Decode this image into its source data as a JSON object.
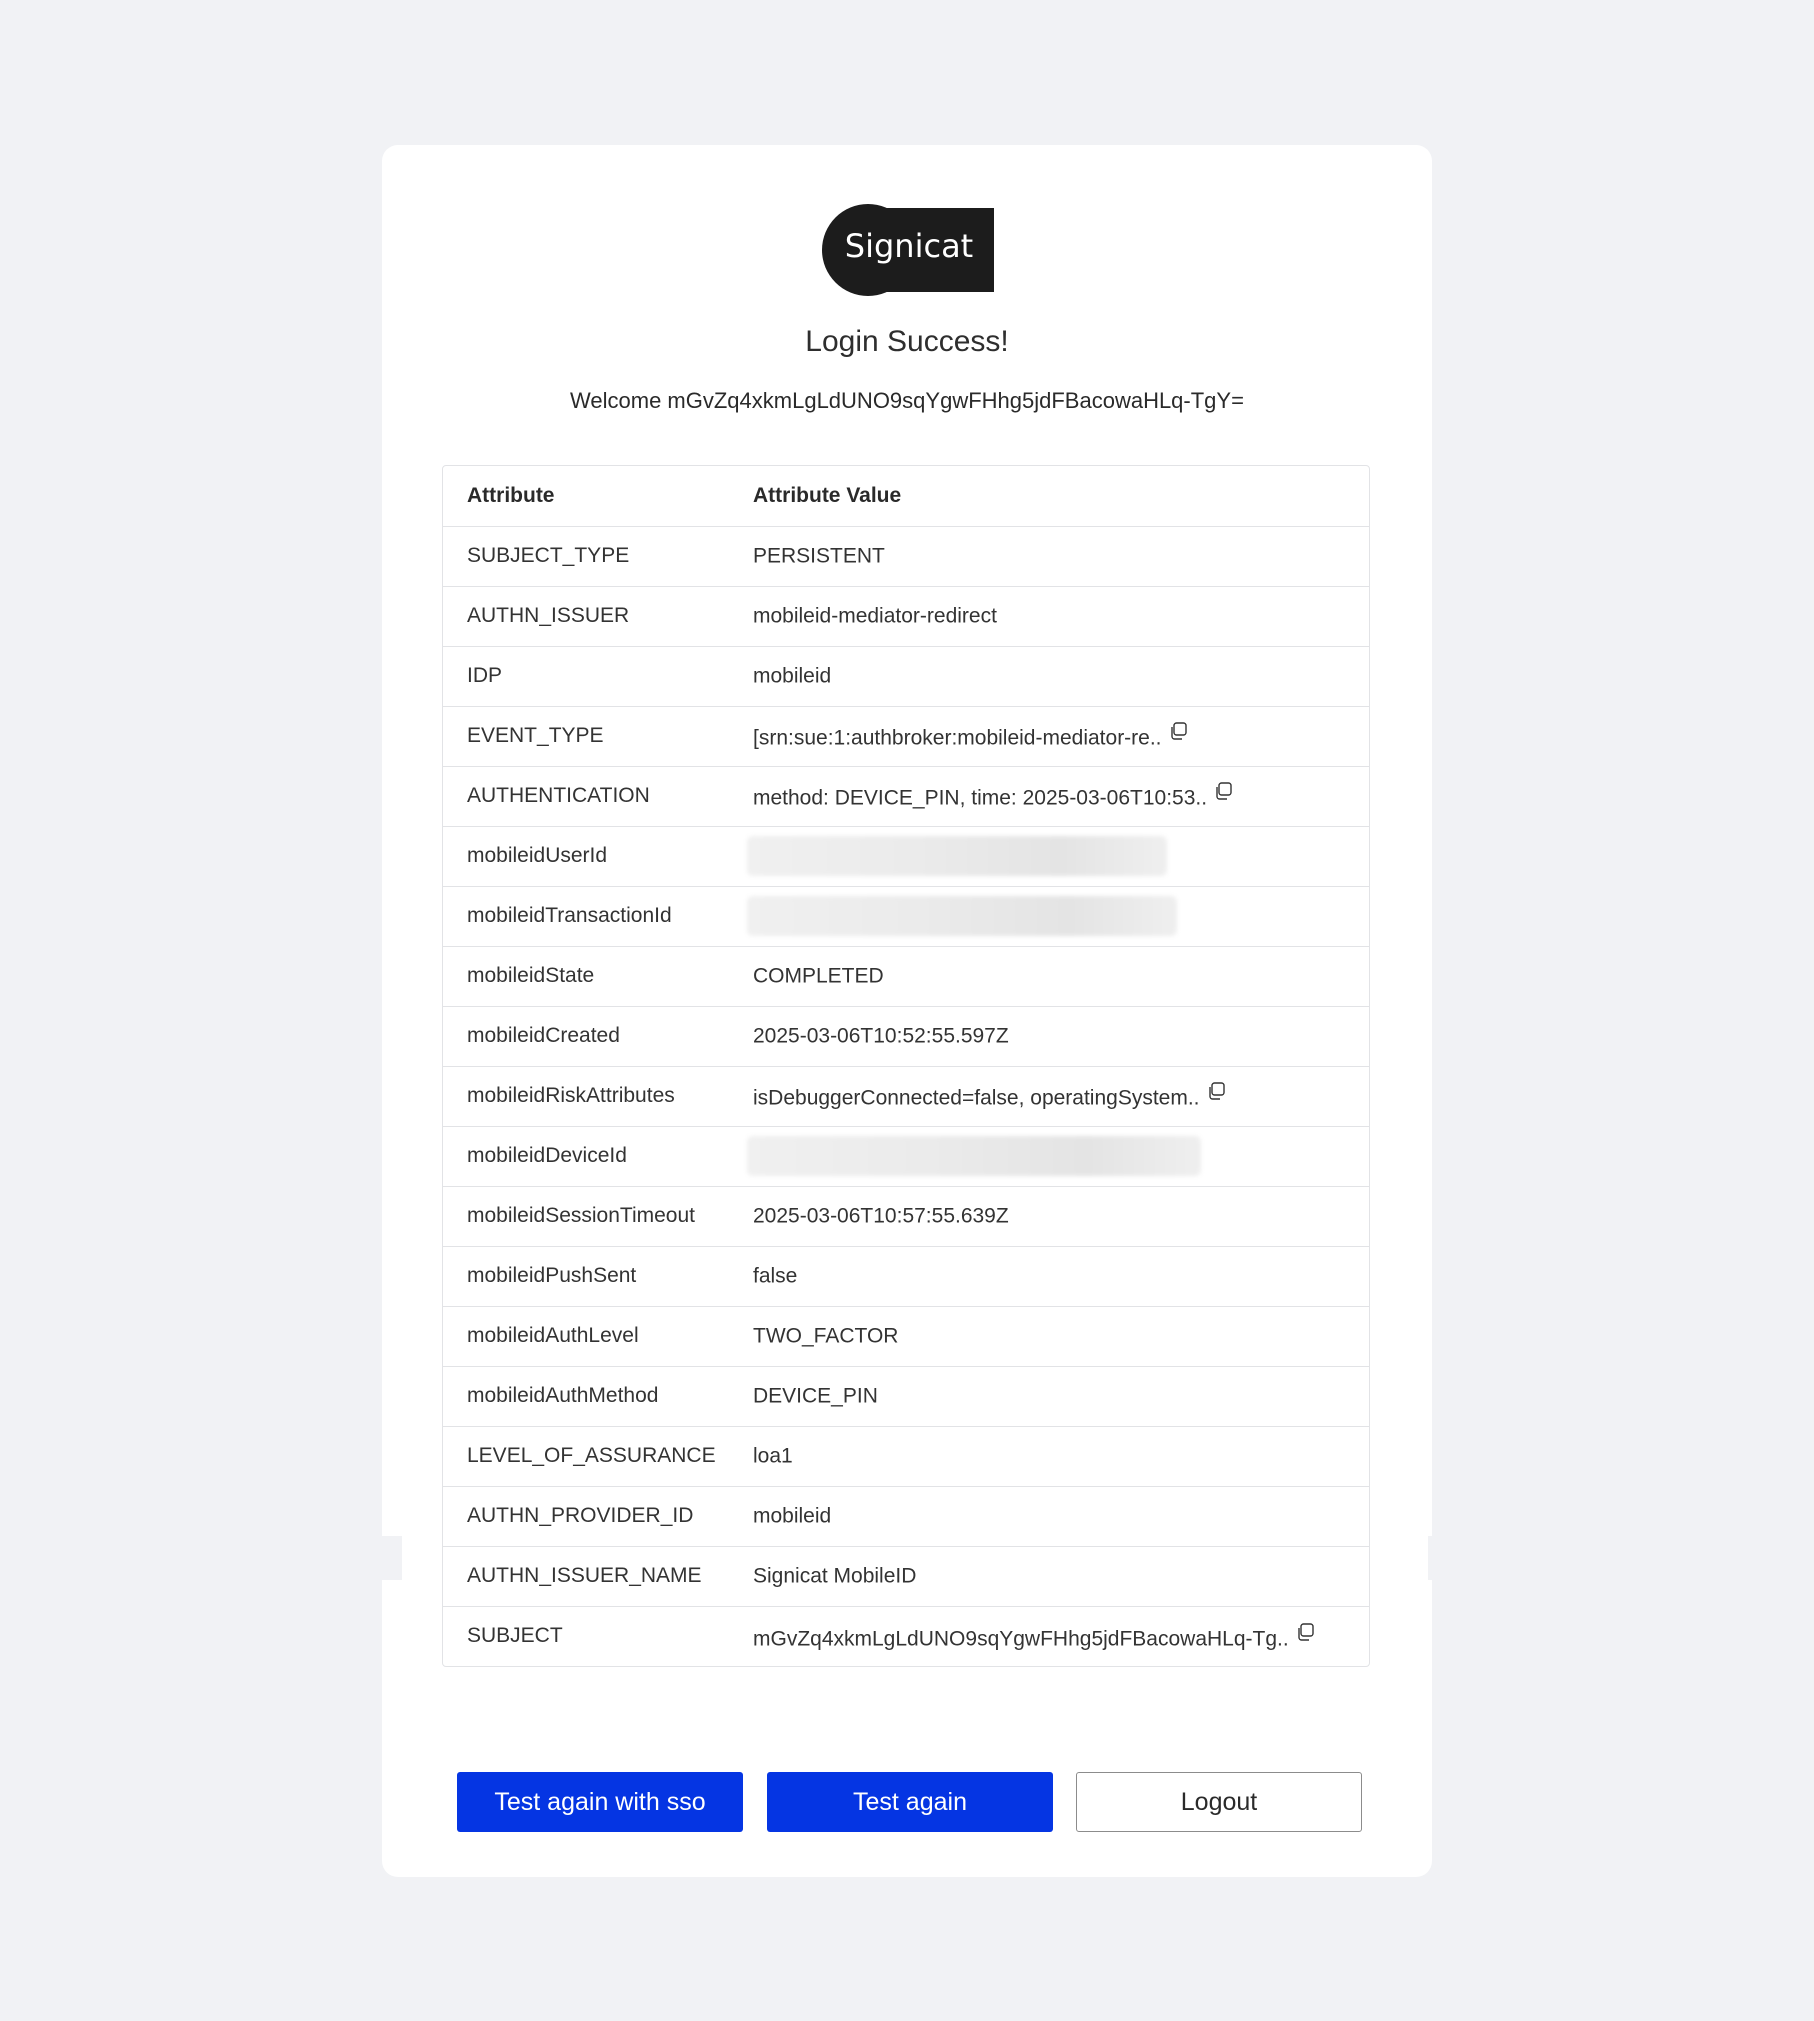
{
  "brand": {
    "logo_text": "Signicat"
  },
  "header": {
    "title": "Login Success!",
    "welcome": "Welcome mGvZq4xkmLgLdUNO9sqYgwFHhg5jdFBacowaHLq-TgY="
  },
  "table": {
    "headers": [
      "Attribute",
      "Attribute Value"
    ],
    "rows": [
      {
        "attr": "SUBJECT_TYPE",
        "value": "PERSISTENT",
        "copy": false,
        "redacted": false
      },
      {
        "attr": "AUTHN_ISSUER",
        "value": "mobileid-mediator-redirect",
        "copy": false,
        "redacted": false
      },
      {
        "attr": "IDP",
        "value": "mobileid",
        "copy": false,
        "redacted": false
      },
      {
        "attr": "EVENT_TYPE",
        "value": "[srn:sue:1:authbroker:mobileid-mediator-re..",
        "copy": true,
        "redacted": false
      },
      {
        "attr": "AUTHENTICATION",
        "value": "method: DEVICE_PIN, time: 2025-03-06T10:53..",
        "copy": true,
        "redacted": false
      },
      {
        "attr": "mobileidUserId",
        "value": "",
        "copy": false,
        "redacted": true
      },
      {
        "attr": "mobileidTransactionId",
        "value": "",
        "copy": false,
        "redacted": true
      },
      {
        "attr": "mobileidState",
        "value": "COMPLETED",
        "copy": false,
        "redacted": false
      },
      {
        "attr": "mobileidCreated",
        "value": "2025-03-06T10:52:55.597Z",
        "copy": false,
        "redacted": false
      },
      {
        "attr": "mobileidRiskAttributes",
        "value": "isDebuggerConnected=false, operatingSystem..",
        "copy": true,
        "redacted": false
      },
      {
        "attr": "mobileidDeviceId",
        "value": "",
        "copy": false,
        "redacted": true
      },
      {
        "attr": "mobileidSessionTimeout",
        "value": "2025-03-06T10:57:55.639Z",
        "copy": false,
        "redacted": false
      },
      {
        "attr": "mobileidPushSent",
        "value": "false",
        "copy": false,
        "redacted": false
      },
      {
        "attr": "mobileidAuthLevel",
        "value": "TWO_FACTOR",
        "copy": false,
        "redacted": false
      },
      {
        "attr": "mobileidAuthMethod",
        "value": "DEVICE_PIN",
        "copy": false,
        "redacted": false
      },
      {
        "attr": "LEVEL_OF_ASSURANCE",
        "value": "loa1",
        "copy": false,
        "redacted": false
      },
      {
        "attr": "AUTHN_PROVIDER_ID",
        "value": "mobileid",
        "copy": false,
        "redacted": false
      },
      {
        "attr": "AUTHN_ISSUER_NAME",
        "value": "Signicat MobileID",
        "copy": false,
        "redacted": false
      },
      {
        "attr": "SUBJECT",
        "value": "mGvZq4xkmLgLdUNO9sqYgwFHhg5jdFBacowaHLq-Tg..",
        "copy": true,
        "redacted": false
      }
    ]
  },
  "actions": {
    "test_sso_label": "Test again with sso",
    "test_again_label": "Test again",
    "logout_label": "Logout"
  },
  "colors": {
    "primary": "#0535e3",
    "background": "#f1f2f5",
    "logo": "#1c1c1c"
  },
  "icons": {
    "copy": "copy-icon"
  }
}
